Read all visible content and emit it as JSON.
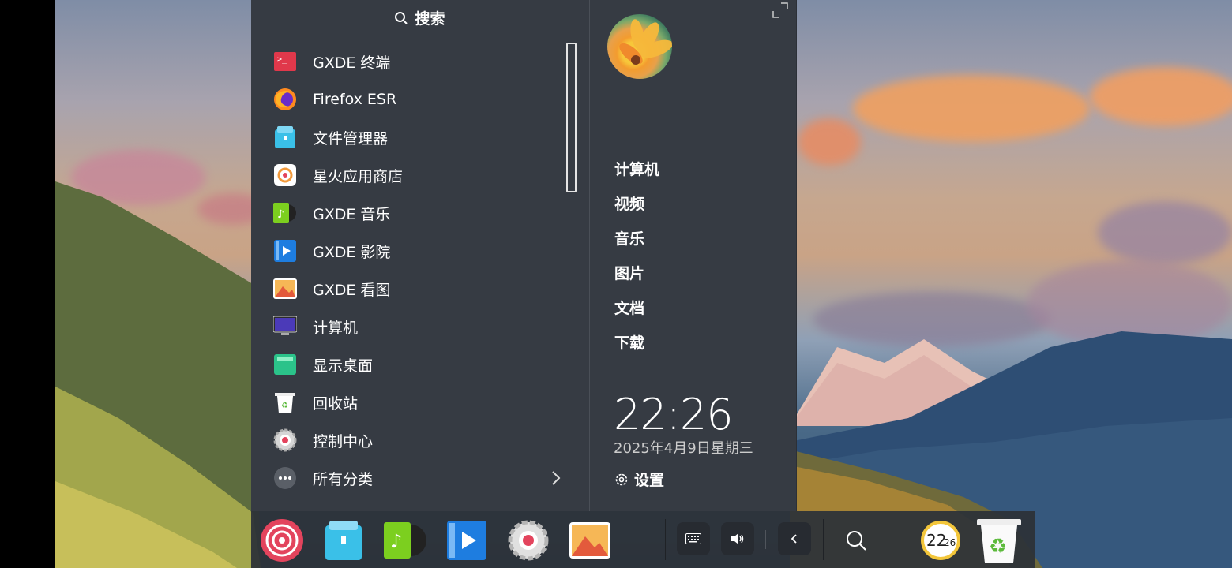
{
  "search": {
    "label": "搜索"
  },
  "apps": [
    {
      "label": "GXDE 终端",
      "icon": "terminal-icon"
    },
    {
      "label": "Firefox ESR",
      "icon": "firefox-icon"
    },
    {
      "label": "文件管理器",
      "icon": "file-manager-icon"
    },
    {
      "label": "星火应用商店",
      "icon": "spark-store-icon"
    },
    {
      "label": "GXDE 音乐",
      "icon": "music-icon"
    },
    {
      "label": "GXDE 影院",
      "icon": "movie-icon"
    },
    {
      "label": "GXDE 看图",
      "icon": "image-viewer-icon"
    },
    {
      "label": "计算机",
      "icon": "computer-icon"
    },
    {
      "label": "显示桌面",
      "icon": "show-desktop-icon"
    },
    {
      "label": "回收站",
      "icon": "trash-icon"
    },
    {
      "label": "控制中心",
      "icon": "control-center-icon"
    },
    {
      "label": "所有分类",
      "icon": "more-icon"
    }
  ],
  "places": [
    "计算机",
    "视频",
    "音乐",
    "图片",
    "文档",
    "下载"
  ],
  "clock": {
    "time": "22:26",
    "date": "2025年4月9日星期三"
  },
  "settings": {
    "label": "设置"
  },
  "dock": {
    "apps": [
      "launcher-icon",
      "file-manager-icon",
      "music-icon",
      "movie-icon",
      "control-center-icon",
      "image-viewer-icon"
    ],
    "clock_badge": {
      "hour": "22",
      "minute": "26"
    }
  },
  "colors": {
    "menu_bg": "#363b43",
    "dock_bg": "#2d3238",
    "accent": "#e3445d"
  }
}
